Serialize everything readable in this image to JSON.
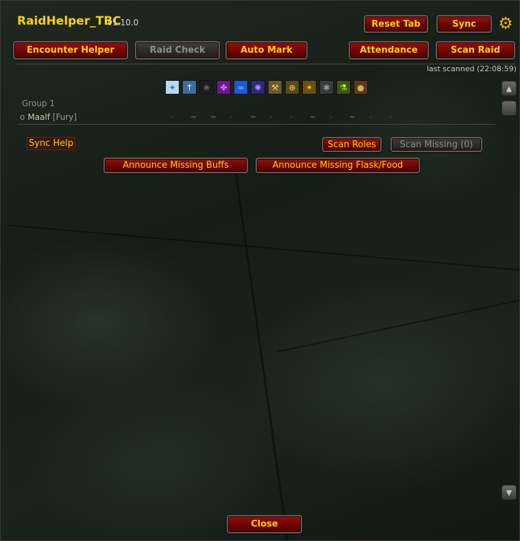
{
  "header": {
    "title": "RaidHelper_TBC",
    "version": "v1.10.0",
    "reset_tab_label": "Reset Tab",
    "sync_label": "Sync"
  },
  "tabs": [
    {
      "label": "Encounter Helper",
      "active": false
    },
    {
      "label": "Raid Check",
      "active": true
    },
    {
      "label": "Auto Mark",
      "active": false
    },
    {
      "label": "Attendance",
      "active": false
    },
    {
      "label": "Scan Raid",
      "active": false
    }
  ],
  "last_scanned": "last scanned (22:08:59)",
  "buff_icons": [
    {
      "name": "fortitude-icon",
      "bg": "#b8d8f0",
      "fg": "#3a7ab8"
    },
    {
      "name": "spirit-icon",
      "bg": "#3a6e9e",
      "fg": "#ffffff"
    },
    {
      "name": "shadow-protection-icon",
      "bg": "#1c1c1c",
      "fg": "#6a6a6a"
    },
    {
      "name": "arcane-intellect-icon",
      "bg": "#6a1a8a",
      "fg": "#e080ff"
    },
    {
      "name": "mark-of-the-wild-icon",
      "bg": "#1a5ad8",
      "fg": "#9ac8ff"
    },
    {
      "name": "thorns-icon",
      "bg": "#2a2a7a",
      "fg": "#b88aff"
    },
    {
      "name": "blessing-of-kings-icon",
      "bg": "#6a5a2a",
      "fg": "#f0d070"
    },
    {
      "name": "blessing-of-might-icon",
      "bg": "#5a4a18",
      "fg": "#ffd24a"
    },
    {
      "name": "blessing-of-wisdom-icon",
      "bg": "#6a5010",
      "fg": "#ffcc33"
    },
    {
      "name": "blessing-of-salvation-icon",
      "bg": "#3a3a3a",
      "fg": "#9a9a9a"
    },
    {
      "name": "flask-icon",
      "bg": "#3a5a10",
      "fg": "#c8ff3a"
    },
    {
      "name": "food-icon",
      "bg": "#5a3a18",
      "fg": "#d8a868"
    }
  ],
  "group": {
    "label": "Group 1",
    "member": {
      "bullet": "o",
      "name": "Maalf",
      "spec": "[Fury]",
      "statuses": [
        "-",
        "~",
        "~",
        "-",
        "~",
        "-",
        "-",
        "~",
        "-",
        "~",
        "-",
        "-"
      ]
    }
  },
  "actions": {
    "sync_help": "Sync Help",
    "scan_roles": "Scan Roles",
    "scan_missing": "Scan Missing (0)",
    "announce_buffs": "Announce Missing Buffs",
    "announce_flask": "Announce Missing Flask/Food",
    "close": "Close"
  },
  "colors": {
    "accent": "#ffd200",
    "button_red": "#7a0804",
    "status_missing": "#d22a1a"
  }
}
